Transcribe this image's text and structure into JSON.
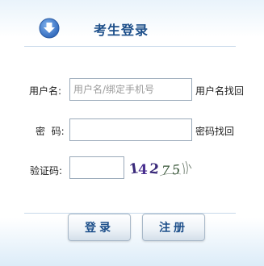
{
  "header": {
    "title": "考生登录",
    "icon": "down-arrow-circle-icon"
  },
  "form": {
    "username_label": "用户名:",
    "username_placeholder": "用户名/绑定手机号",
    "username_value": "",
    "username_recover": "用户名找回",
    "password_label": "密  码:",
    "password_value": "",
    "password_recover": "密码找回",
    "captcha_label": "验证码:",
    "captcha_value": "",
    "captcha_image_text": "14275"
  },
  "buttons": {
    "login": "登录",
    "register": "注册"
  },
  "colors": {
    "accent": "#1d4f8a",
    "icon": "#3f7fd0"
  }
}
